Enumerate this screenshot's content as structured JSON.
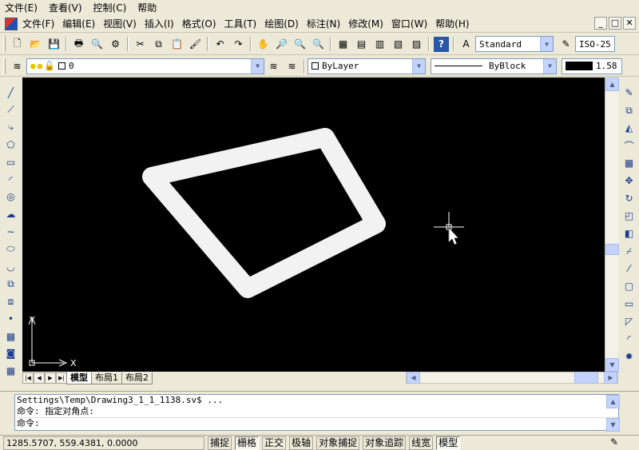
{
  "top_menu": [
    "文件(E)",
    "查看(V)",
    "控制(C)",
    "帮助"
  ],
  "inner_menu": [
    "文件(F)",
    "编辑(E)",
    "视图(V)",
    "插入(I)",
    "格式(O)",
    "工具(T)",
    "绘图(D)",
    "标注(N)",
    "修改(M)",
    "窗口(W)",
    "帮助(H)"
  ],
  "window_buttons": [
    "_",
    "□",
    "✕"
  ],
  "toolbar": {
    "text_style": "Standard",
    "dim_style": "ISO-25",
    "layer": "0",
    "color": "ByLayer",
    "linetype": "ByBlock",
    "lineweight": "1.58"
  },
  "ucs": {
    "x_label": "X",
    "y_label": "Y"
  },
  "layout_tabs": [
    "模型",
    "布局1",
    "布局2"
  ],
  "command": {
    "line1": "Settings\\Temp\\Drawing3_1_1_1138.sv$ ...",
    "line2": "命令: 指定对角点:",
    "prompt": "命令:"
  },
  "status": {
    "coords": "1285.5707, 559.4381, 0.0000",
    "toggles": [
      "捕捉",
      "栅格",
      "正交",
      "极轴",
      "对象捕捉",
      "对象追踪",
      "线宽",
      "模型"
    ],
    "active_toggles": [
      "栅格",
      "模型"
    ]
  },
  "colors": {
    "canvas": "#000000",
    "shape_stroke": "#f2f2f2",
    "chrome": "#ece9d8"
  }
}
